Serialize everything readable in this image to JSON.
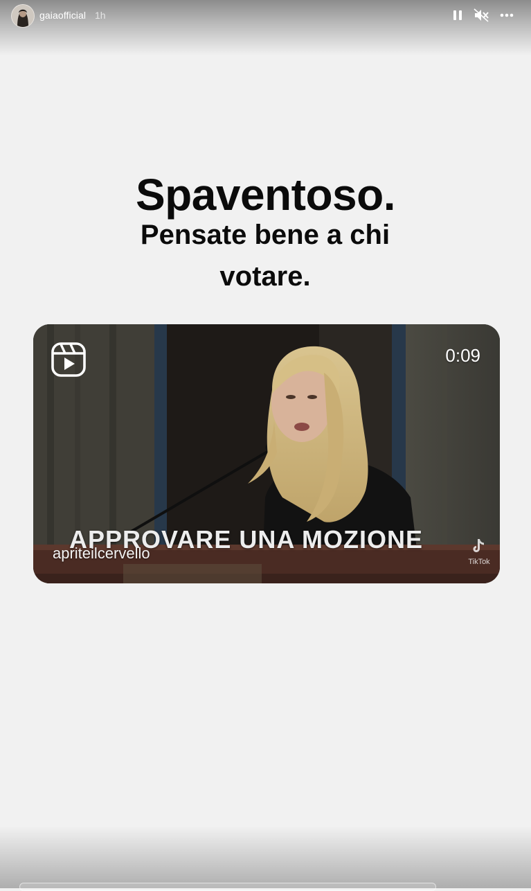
{
  "header": {
    "username": "gaiaofficial",
    "time": "1h",
    "icons": [
      "avatar",
      "pause-icon",
      "mute-icon",
      "more-icon"
    ]
  },
  "story": {
    "headline": "Spaventoso.",
    "subline": "Pensate bene a chi votare."
  },
  "reel": {
    "duration": "0:09",
    "caption": "APPROVARE UNA MOZIONE",
    "watermark": "apriteilcervello",
    "tiktok_label": "TikTok",
    "icon": "reels-icon"
  },
  "colors": {
    "background": "#f1f1f1",
    "text": "#0b0b0b",
    "header_text": "#ffffff"
  }
}
